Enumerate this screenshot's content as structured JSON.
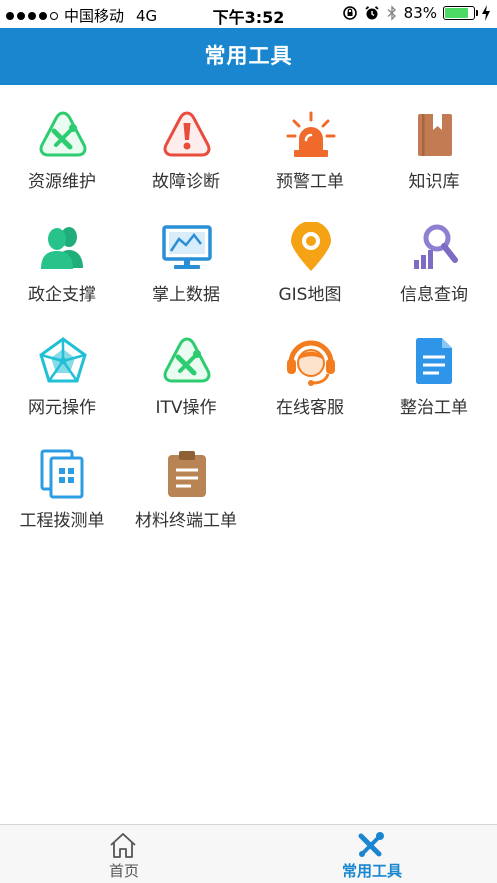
{
  "status": {
    "carrier": "中国移动",
    "network": "4G",
    "time": "下午3:52",
    "battery": "83%",
    "battery_level": 0.83
  },
  "header": {
    "title": "常用工具"
  },
  "tools": [
    {
      "label": "资源维护",
      "icon": "wrench-triangle-icon",
      "color": "#2ecc71"
    },
    {
      "label": "故障诊断",
      "icon": "exclamation-triangle-icon",
      "color": "#e74c3c"
    },
    {
      "label": "预警工单",
      "icon": "alarm-light-icon",
      "color": "#f06a2c"
    },
    {
      "label": "知识库",
      "icon": "book-icon",
      "color": "#c27b53"
    },
    {
      "label": "政企支撑",
      "icon": "users-icon",
      "color": "#27c38b"
    },
    {
      "label": "掌上数据",
      "icon": "monitor-chart-icon",
      "color": "#2a8fd6"
    },
    {
      "label": "GIS地图",
      "icon": "map-pin-icon",
      "color": "#f5a214"
    },
    {
      "label": "信息查询",
      "icon": "search-chart-icon",
      "color": "#7e6cc4"
    },
    {
      "label": "网元操作",
      "icon": "network-pentagon-icon",
      "color": "#21c0d6"
    },
    {
      "label": "ITV操作",
      "icon": "wrench-triangle-icon",
      "color": "#2ecc71"
    },
    {
      "label": "在线客服",
      "icon": "headset-agent-icon",
      "color": "#f27c1e"
    },
    {
      "label": "整治工单",
      "icon": "document-icon",
      "color": "#2f95e8"
    },
    {
      "label": "工程拨测单",
      "icon": "documents-grid-icon",
      "color": "#2b9ee3"
    },
    {
      "label": "材料终端工单",
      "icon": "clipboard-icon",
      "color": "#b98453"
    }
  ],
  "tabbar": {
    "items": [
      {
        "label": "首页",
        "icon": "home-icon",
        "active": false
      },
      {
        "label": "常用工具",
        "icon": "tools-icon",
        "active": true
      }
    ],
    "active_color": "#1a86cf",
    "inactive_color": "#555555"
  }
}
